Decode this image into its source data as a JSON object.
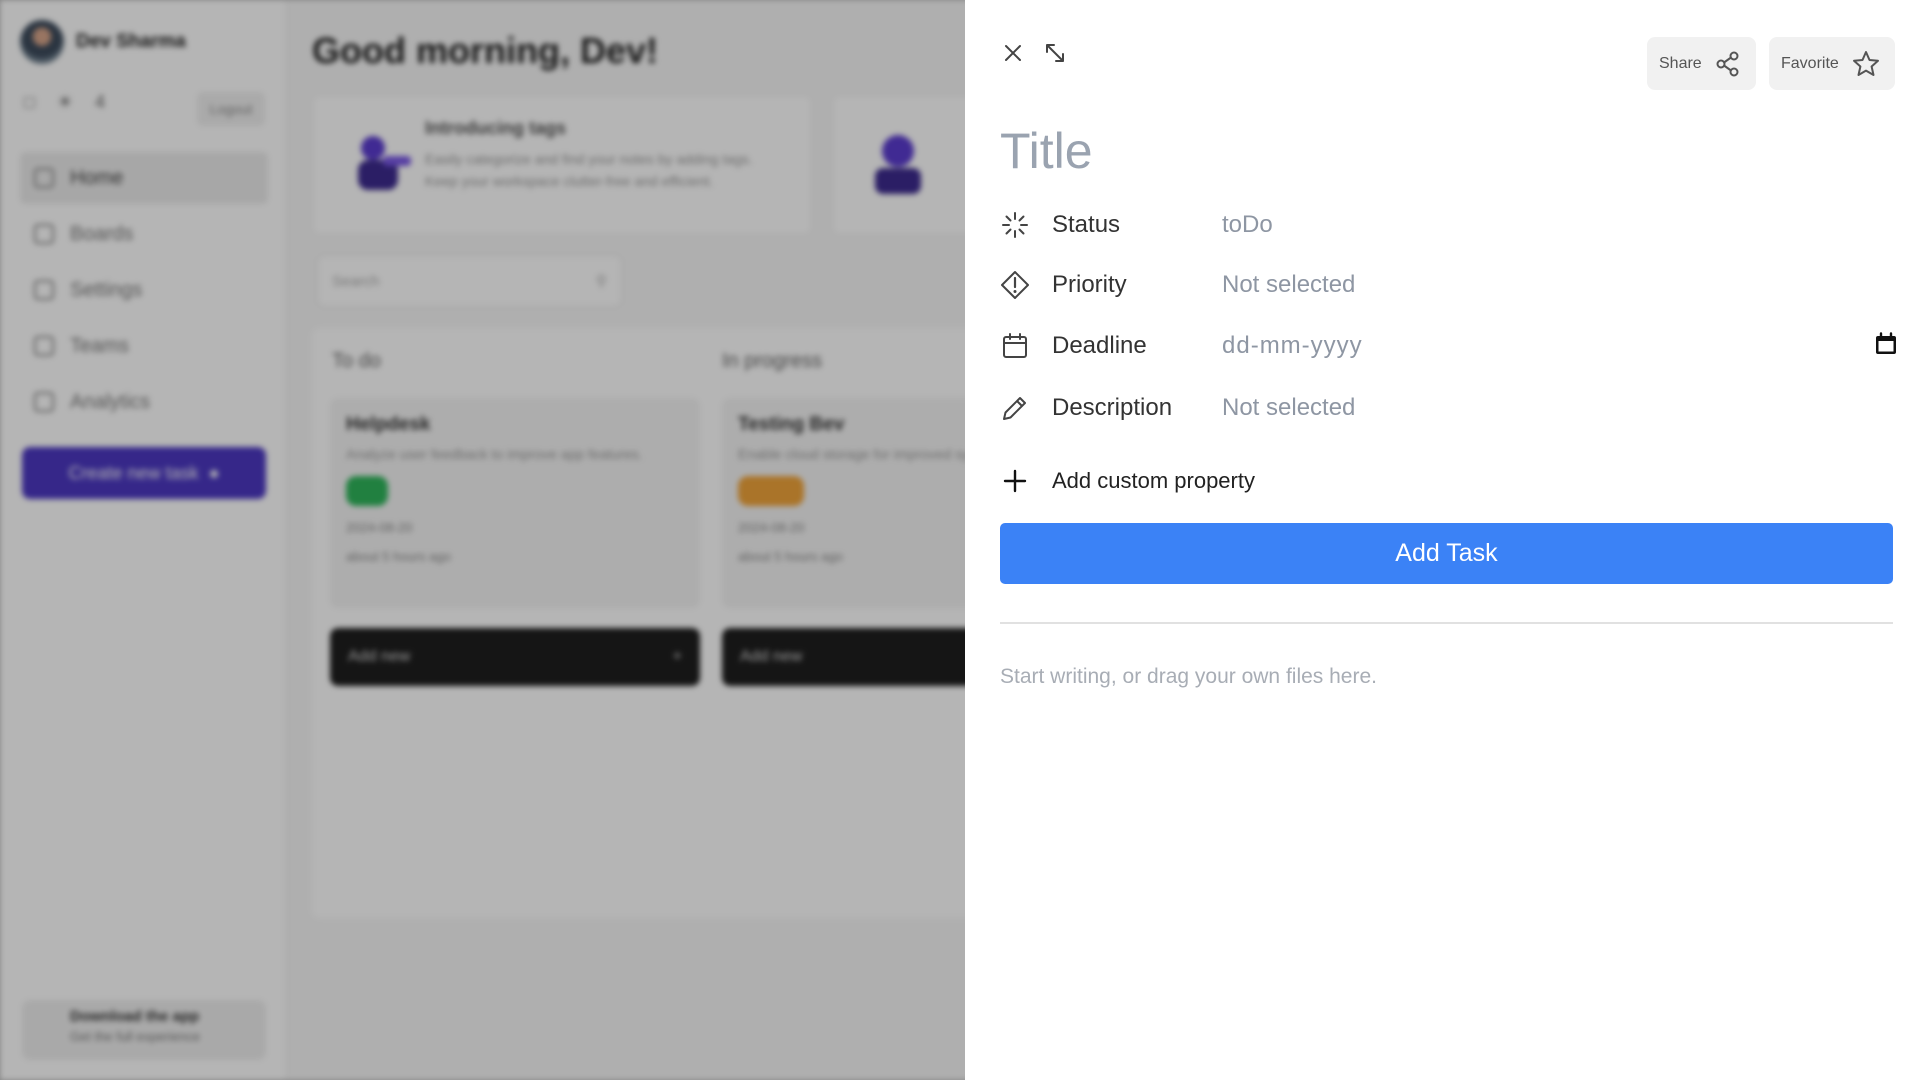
{
  "background": {
    "sidebar": {
      "user_name": "Dev Sharma",
      "badge_count": "4",
      "logout_label": "Logout",
      "nav": [
        "Home",
        "Boards",
        "Settings",
        "Teams",
        "Analytics"
      ],
      "create_label": "Create new task",
      "download_title": "Download the app",
      "download_sub": "Get the full experience"
    },
    "greeting": "Good morning, Dev!",
    "feature": {
      "title": "Introducing tags",
      "desc": "Easily categorize and find your notes by adding tags. Keep your workspace clutter-free and efficient."
    },
    "search_placeholder": "Search",
    "columns": [
      "To do",
      "In progress"
    ],
    "cards": [
      {
        "title": "Helpdesk",
        "desc": "Analyze user feedback to improve app features.",
        "meta": "2024-08-20",
        "time": "about 5 hours ago"
      },
      {
        "title": "Testing Bev",
        "desc": "Enable cloud storage for improved synchronization.",
        "meta": "2024-08-20",
        "time": "about 5 hours ago"
      }
    ],
    "add_new_label": "Add new"
  },
  "drawer": {
    "share_label": "Share",
    "favorite_label": "Favorite",
    "title_placeholder": "Title",
    "properties": {
      "status": {
        "label": "Status",
        "value": "toDo"
      },
      "priority": {
        "label": "Priority",
        "value": "Not selected"
      },
      "deadline": {
        "label": "Deadline",
        "value": "dd-mm-yyyy"
      },
      "description": {
        "label": "Description",
        "value": "Not selected"
      }
    },
    "add_custom_label": "Add custom property",
    "add_task_label": "Add Task",
    "editor_placeholder": "Start writing, or drag your own files here."
  },
  "colors": {
    "primary_button": "#3b82f6",
    "create_button": "#4c38c2",
    "placeholder_text": "#9aa3b0"
  },
  "icons": [
    "close-icon",
    "expand-icon",
    "share-icon",
    "star-icon",
    "status-spinner-icon",
    "priority-diamond-icon",
    "calendar-icon",
    "pencil-icon",
    "plus-icon"
  ]
}
